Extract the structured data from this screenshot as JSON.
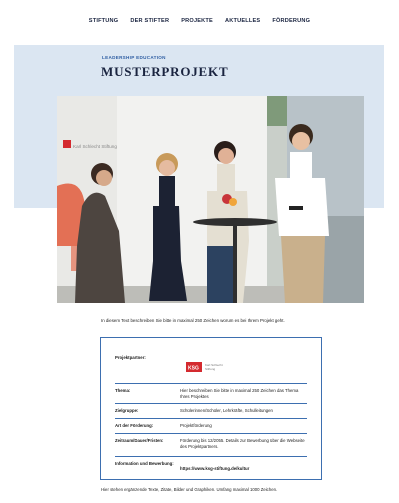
{
  "nav": {
    "items": [
      "STIFTUNG",
      "DER STIFTER",
      "PROJEKTE",
      "AKTUELLES",
      "FÖRDERUNG"
    ]
  },
  "hero": {
    "kicker": "LEADERSHIP EDUCATION",
    "title": "MUSTERPROJEKT",
    "photo_icon": "event-photo",
    "banner_logo_text": "Karl Schlecht Stiftung"
  },
  "intro_text": "In diesem Text beschreiben Sie bitte in maximal 250 Zeichen worum es bei Ihrem Projekt geht.",
  "infobox": {
    "partner_label": "Projektpartner:",
    "partner_logo_text": "KSG Karl Schlecht Stiftung",
    "rows": [
      {
        "label": "Thema:",
        "value": "Hier beschreiben Sie bitte in maximal 250 Zeichen das Thema Ihres Projektes"
      },
      {
        "label": "Zielgruppe:",
        "value": "Schülerinnen/Schüler, Lehrkräfte, Schulleitungen"
      },
      {
        "label": "Art der Förderung:",
        "value": "Projektförderung"
      },
      {
        "label": "Zeitraum/Dauer/Fristen:",
        "value": "Förderung bis 12/2055. Details zur Bewerbung über die Webseite des Projektpartners."
      },
      {
        "label": "Information und Bewerbung:",
        "value": "https://www.ksg-stiftung.de/kultur"
      }
    ]
  },
  "footnote": "Hier stehen ergänzende Texte, Zitate, Bilder und Graphiken. Umfang maximal 1000 Zeichen.",
  "colors": {
    "accent": "#3d6fb0",
    "band": "#dbe6f2",
    "logo_red": "#d42a2f"
  }
}
